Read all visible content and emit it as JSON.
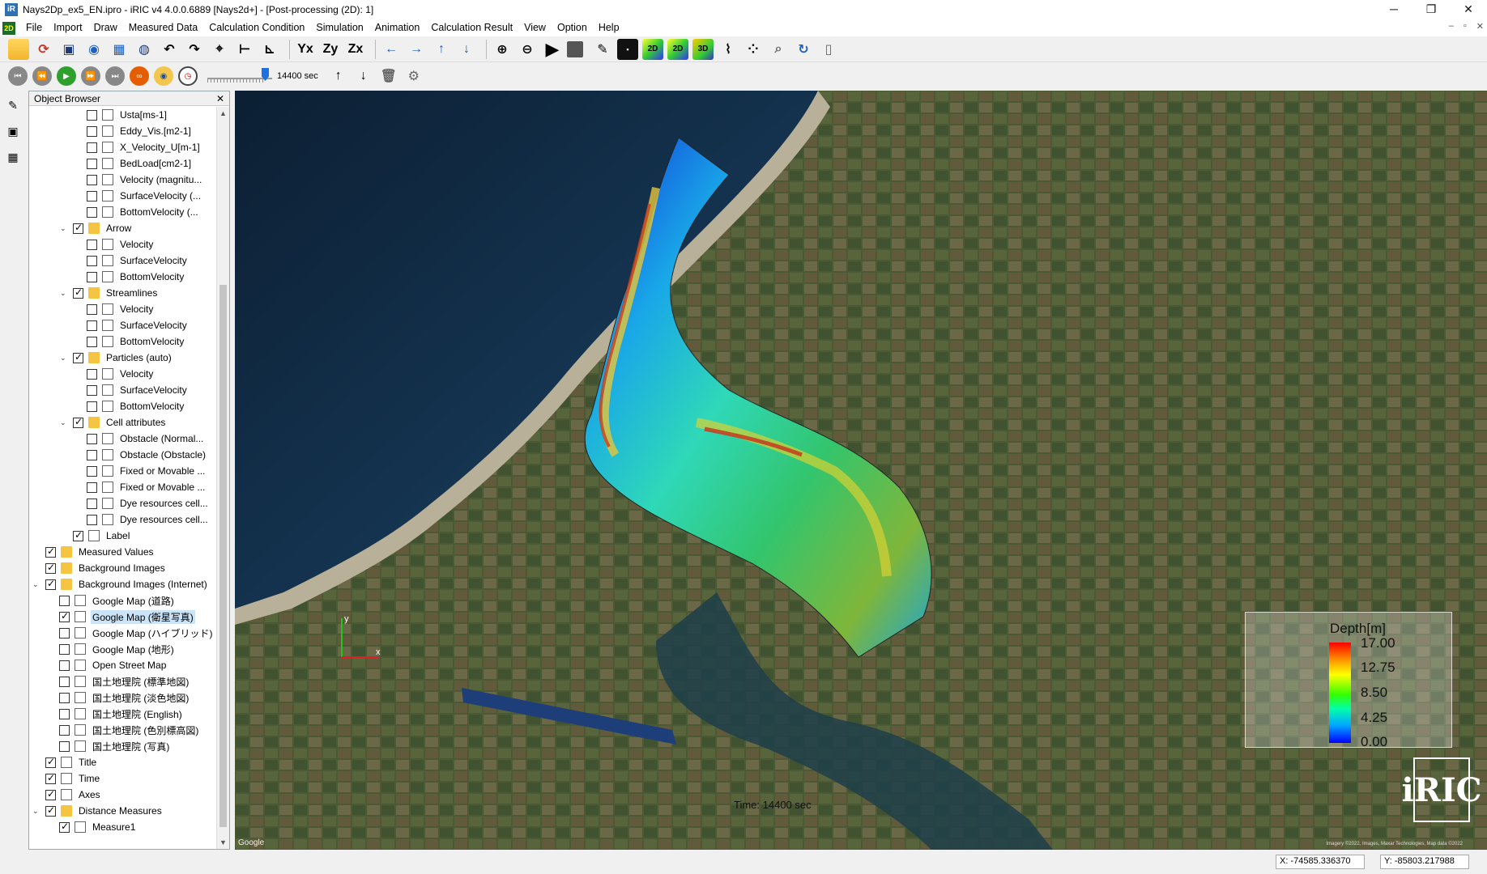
{
  "window": {
    "title": "Nays2Dp_ex5_EN.ipro - iRIC v4 4.0.0.6889 [Nays2d+] - [Post-processing (2D): 1]",
    "app_icon": "iric-app-icon",
    "controls": [
      "─",
      "❐",
      "✕"
    ]
  },
  "menu": {
    "items": [
      "File",
      "Import",
      "Draw",
      "Measured Data",
      "Calculation Condition",
      "Simulation",
      "Animation",
      "Calculation Result",
      "View",
      "Option",
      "Help"
    ],
    "mdi_controls": [
      "–",
      "▫",
      "✕"
    ]
  },
  "toolbar2": {
    "time_value": "14400 sec"
  },
  "object_browser": {
    "title": "Object Browser",
    "close": "✕",
    "rows": [
      {
        "label": "Usta[ms-1]",
        "indent": 3,
        "type": "doc",
        "checked": false,
        "expander": ""
      },
      {
        "label": "Eddy_Vis.[m2-1]",
        "indent": 3,
        "type": "doc",
        "checked": false,
        "expander": ""
      },
      {
        "label": "X_Velocity_U[m-1]",
        "indent": 3,
        "type": "doc",
        "checked": false,
        "expander": ""
      },
      {
        "label": "BedLoad[cm2-1]",
        "indent": 3,
        "type": "doc",
        "checked": false,
        "expander": ""
      },
      {
        "label": "Velocity (magnitu...",
        "indent": 3,
        "type": "doc",
        "checked": false,
        "expander": ""
      },
      {
        "label": "SurfaceVelocity (...",
        "indent": 3,
        "type": "doc",
        "checked": false,
        "expander": ""
      },
      {
        "label": "BottomVelocity (...",
        "indent": 3,
        "type": "doc",
        "checked": false,
        "expander": ""
      },
      {
        "label": "Arrow",
        "indent": 2,
        "type": "folder",
        "checked": true,
        "expander": "v"
      },
      {
        "label": "Velocity",
        "indent": 3,
        "type": "doc",
        "checked": false,
        "expander": ""
      },
      {
        "label": "SurfaceVelocity",
        "indent": 3,
        "type": "doc",
        "checked": false,
        "expander": ""
      },
      {
        "label": "BottomVelocity",
        "indent": 3,
        "type": "doc",
        "checked": false,
        "expander": ""
      },
      {
        "label": "Streamlines",
        "indent": 2,
        "type": "folder",
        "checked": true,
        "expander": "v"
      },
      {
        "label": "Velocity",
        "indent": 3,
        "type": "doc",
        "checked": false,
        "expander": ""
      },
      {
        "label": "SurfaceVelocity",
        "indent": 3,
        "type": "doc",
        "checked": false,
        "expander": ""
      },
      {
        "label": "BottomVelocity",
        "indent": 3,
        "type": "doc",
        "checked": false,
        "expander": ""
      },
      {
        "label": "Particles (auto)",
        "indent": 2,
        "type": "folder",
        "checked": true,
        "expander": "v"
      },
      {
        "label": "Velocity",
        "indent": 3,
        "type": "doc",
        "checked": false,
        "expander": ""
      },
      {
        "label": "SurfaceVelocity",
        "indent": 3,
        "type": "doc",
        "checked": false,
        "expander": ""
      },
      {
        "label": "BottomVelocity",
        "indent": 3,
        "type": "doc",
        "checked": false,
        "expander": ""
      },
      {
        "label": "Cell attributes",
        "indent": 2,
        "type": "folder",
        "checked": true,
        "expander": "v"
      },
      {
        "label": "Obstacle (Normal...",
        "indent": 3,
        "type": "doc",
        "checked": false,
        "expander": ""
      },
      {
        "label": "Obstacle (Obstacle)",
        "indent": 3,
        "type": "doc",
        "checked": false,
        "expander": ""
      },
      {
        "label": "Fixed or Movable ...",
        "indent": 3,
        "type": "doc",
        "checked": false,
        "expander": ""
      },
      {
        "label": "Fixed or Movable ...",
        "indent": 3,
        "type": "doc",
        "checked": false,
        "expander": ""
      },
      {
        "label": "Dye resources cell...",
        "indent": 3,
        "type": "doc",
        "checked": false,
        "expander": ""
      },
      {
        "label": "Dye resources cell...",
        "indent": 3,
        "type": "doc",
        "checked": false,
        "expander": ""
      },
      {
        "label": "Label",
        "indent": 2,
        "type": "doc",
        "checked": true,
        "expander": ""
      },
      {
        "label": "Measured Values",
        "indent": 0,
        "type": "folder",
        "checked": true,
        "expander": ""
      },
      {
        "label": "Background Images",
        "indent": 0,
        "type": "folder",
        "checked": true,
        "expander": ""
      },
      {
        "label": "Background Images (Internet)",
        "indent": 0,
        "type": "folder",
        "checked": true,
        "expander": "v"
      },
      {
        "label": "Google Map (道路)",
        "indent": 1,
        "type": "doc",
        "checked": false,
        "expander": ""
      },
      {
        "label": "Google Map (衛星写真)",
        "indent": 1,
        "type": "doc",
        "checked": true,
        "expander": "",
        "selected": true
      },
      {
        "label": "Google Map (ハイブリッド)",
        "indent": 1,
        "type": "doc",
        "checked": false,
        "expander": ""
      },
      {
        "label": "Google Map (地形)",
        "indent": 1,
        "type": "doc",
        "checked": false,
        "expander": ""
      },
      {
        "label": "Open Street Map",
        "indent": 1,
        "type": "doc",
        "checked": false,
        "expander": ""
      },
      {
        "label": "国土地理院 (標準地図)",
        "indent": 1,
        "type": "doc",
        "checked": false,
        "expander": ""
      },
      {
        "label": "国土地理院 (淡色地図)",
        "indent": 1,
        "type": "doc",
        "checked": false,
        "expander": ""
      },
      {
        "label": "国土地理院 (English)",
        "indent": 1,
        "type": "doc",
        "checked": false,
        "expander": ""
      },
      {
        "label": "国土地理院 (色別標高図)",
        "indent": 1,
        "type": "doc",
        "checked": false,
        "expander": ""
      },
      {
        "label": "国土地理院 (写真)",
        "indent": 1,
        "type": "doc",
        "checked": false,
        "expander": ""
      },
      {
        "label": "Title",
        "indent": 0,
        "type": "doc",
        "checked": true,
        "expander": ""
      },
      {
        "label": "Time",
        "indent": 0,
        "type": "doc",
        "checked": true,
        "expander": ""
      },
      {
        "label": "Axes",
        "indent": 0,
        "type": "doc",
        "checked": true,
        "expander": ""
      },
      {
        "label": "Distance Measures",
        "indent": 0,
        "type": "folder",
        "checked": true,
        "expander": "v"
      },
      {
        "label": "Measure1",
        "indent": 1,
        "type": "doc",
        "checked": true,
        "expander": ""
      }
    ]
  },
  "map": {
    "time_label": "Time:  14400 sec",
    "google_label": "Google",
    "attribution": "Imagery ©2022, Images, Maxar Technologies, Map data ©2022",
    "axis_x": "x",
    "axis_y": "y",
    "legend": {
      "title": "Depth[m]",
      "labels": [
        "17.00",
        "12.75",
        "8.50",
        "4.25",
        "0.00"
      ]
    },
    "logo_text": "iRIC"
  },
  "status": {
    "x": "X: -74585.336370",
    "y": "Y: -85803.217988"
  }
}
